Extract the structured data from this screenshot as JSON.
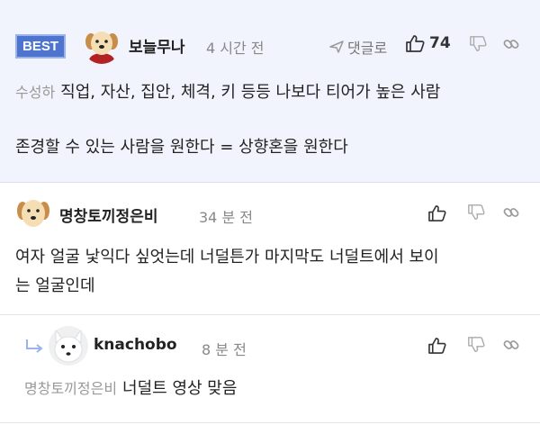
{
  "comments": [
    {
      "badge": "BEST",
      "nickname": "보늘무나",
      "time": "4 시간 전",
      "reply_label": "댓글로",
      "like_count": "74",
      "mention": "수성하",
      "line1": "직업, 자산, 집안, 체격, 키 등등 나보다 티어가 높은 사람",
      "line2": "존경할 수 있는 사람을 원한다 = 상향혼을 원한다"
    },
    {
      "nickname": "명창토끼정은비",
      "time": "34 분 전",
      "line1": "여자 얼굴 낯익다 싶엇는데 너덜튼가 마지막도 너덜트에서 보이",
      "line2": "는 얼굴인데"
    },
    {
      "nickname": "knachobo",
      "time": "8 분 전",
      "mention": "명창토끼정은비",
      "line1": "너덜트 영상 맞음"
    }
  ],
  "icons": {
    "like": "thumbs-up-icon",
    "dislike": "thumbs-down-icon",
    "link": "link-icon",
    "reply": "paper-plane-icon",
    "reply_indicator": "reply-arrow-icon"
  },
  "colors": {
    "best_bg": "#f2f4fd",
    "badge": "#4d74cf",
    "muted": "#888888"
  }
}
